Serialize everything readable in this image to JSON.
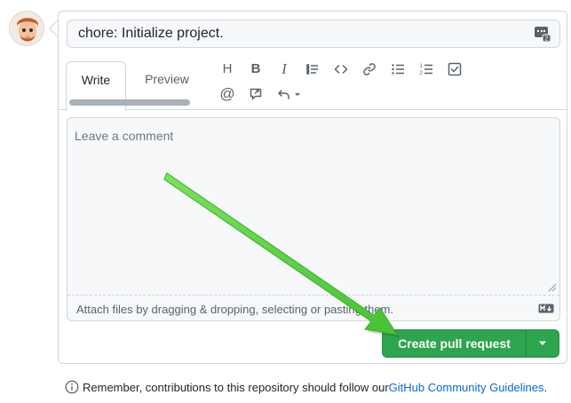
{
  "comment_box": {
    "title_value": "chore: Initialize project.",
    "tabs": [
      {
        "label": "Write",
        "selected": true
      },
      {
        "label": "Preview",
        "selected": false
      }
    ],
    "toolbar": {
      "heading": "H",
      "bold": "B",
      "italic": "I",
      "mention": "@",
      "icons": [
        "heading-icon",
        "bold-icon",
        "italic-icon",
        "quote-icon",
        "code-icon",
        "link-icon",
        "bulleted-list-icon",
        "numbered-list-icon",
        "task-list-icon",
        "mention-icon",
        "reference-icon",
        "undo-icon"
      ]
    },
    "body_placeholder": "Leave a comment",
    "attach_hint": "Attach files by dragging & dropping, selecting or pasting them.",
    "submit_label": "Create pull request"
  },
  "footer": {
    "text": "Remember, contributions to this repository should follow our ",
    "link": "GitHub Community Guidelines",
    "end": "."
  },
  "colors": {
    "accent_green": "#2da44e",
    "link_blue": "#0969da",
    "arrow_green": "#5fd14a"
  }
}
